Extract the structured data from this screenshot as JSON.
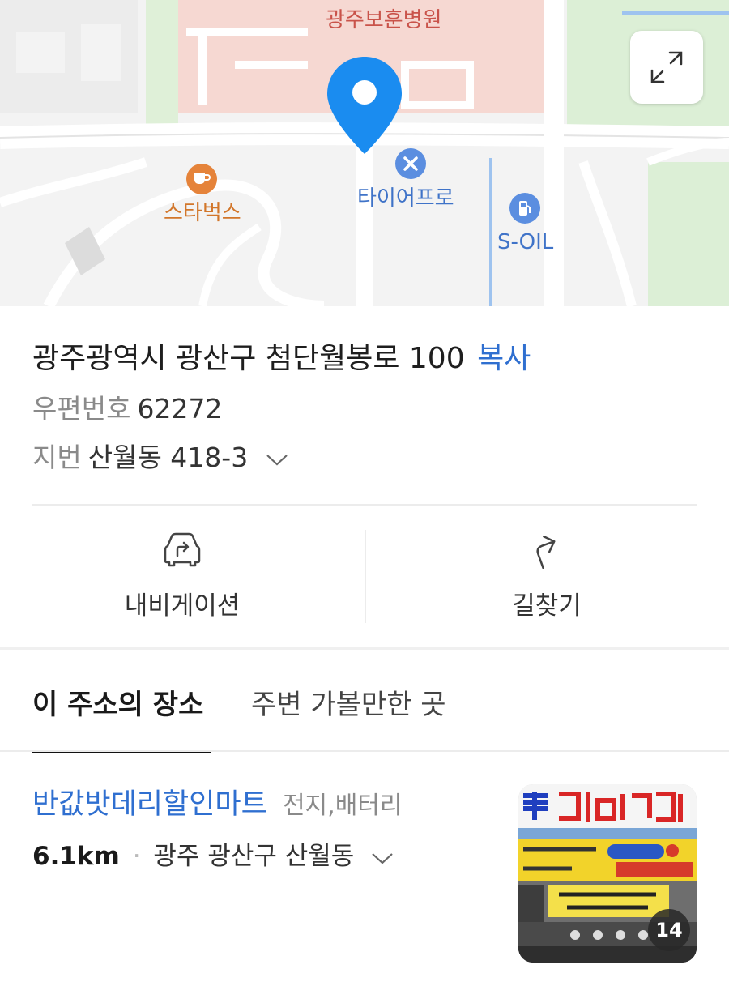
{
  "map": {
    "labels": {
      "hospital": "광주보훈병원",
      "starbucks": "스타벅스",
      "tire": "타이어프로",
      "soil": "S-OIL"
    },
    "pin_color": "#1a8cf0",
    "expand_icon": "expand-icon"
  },
  "address": {
    "road": "광주광역시 광산구 첨단월봉로 100",
    "copy_label": "복사",
    "postal_label": "우편번호",
    "postal_code": "62272",
    "lot_label": "지번",
    "lot_value": "산월동 418-3"
  },
  "actions": {
    "navigation_label": "내비게이션",
    "directions_label": "길찾기"
  },
  "tabs": {
    "active": "이 주소의 장소",
    "inactive": "주변 가볼만한 곳"
  },
  "place": {
    "name": "반값밧데리할인마트",
    "category": "전지,배터리",
    "distance": "6.1km",
    "area": "광주 광산구 산월동",
    "photo_count": "14"
  },
  "colors": {
    "link": "#2f6fd0",
    "accent_pin": "#1a8cf0"
  }
}
